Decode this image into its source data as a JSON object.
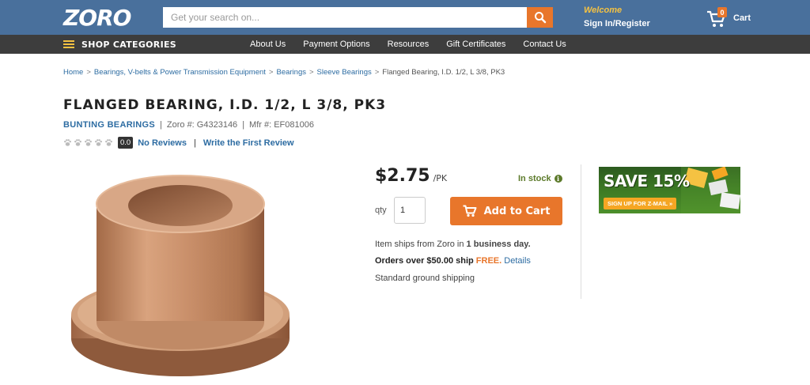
{
  "header": {
    "logo_text": "ZORO",
    "search_placeholder": "Get your search on...",
    "welcome": "Welcome",
    "signin": "Sign In/Register",
    "cart_count": "0",
    "cart_label": "Cart"
  },
  "nav": {
    "shop_categories": "SHOP CATEGORIES",
    "links": [
      "About Us",
      "Payment Options",
      "Resources",
      "Gift Certificates",
      "Contact Us"
    ]
  },
  "breadcrumb": {
    "items": [
      "Home",
      "Bearings, V-belts & Power Transmission Equipment",
      "Bearings",
      "Sleeve Bearings"
    ],
    "separator": ">",
    "current": "Flanged Bearing, I.D. 1/2, L 3/8, PK3"
  },
  "product": {
    "title": "FLANGED BEARING, I.D. 1/2, L 3/8, PK3",
    "brand": "BUNTING BEARINGS",
    "zoro_sku": "Zoro #: G4323146",
    "mfr_sku": "Mfr #: EF081006",
    "meta_sep": "|",
    "rating_score": "0.0",
    "no_reviews": "No Reviews",
    "review_sep": "|",
    "write_review": "Write the First Review",
    "price": "$2.75",
    "price_unit": "/PK",
    "stock": "In stock",
    "qty_label": "qty",
    "qty_value": "1",
    "add_to_cart": "Add to Cart",
    "ship_line1_pre": "Item ships from Zoro in ",
    "ship_line1_bold": "1 business day.",
    "ship_line2_pre": "Orders over $50.00 ship ",
    "ship_line2_free": "FREE.",
    "ship_line2_link": "Details",
    "ship_line3": "Standard ground shipping"
  },
  "promo": {
    "title": "SAVE 15%",
    "cta": "SIGN UP FOR Z-MAIL »"
  },
  "colors": {
    "header_bg": "#49709c",
    "nav_bg": "#3d3d3d",
    "accent_orange": "#e8762b",
    "link_blue": "#2d6ca2",
    "welcome_yellow": "#f5c242",
    "stock_green": "#5c7a2a"
  }
}
